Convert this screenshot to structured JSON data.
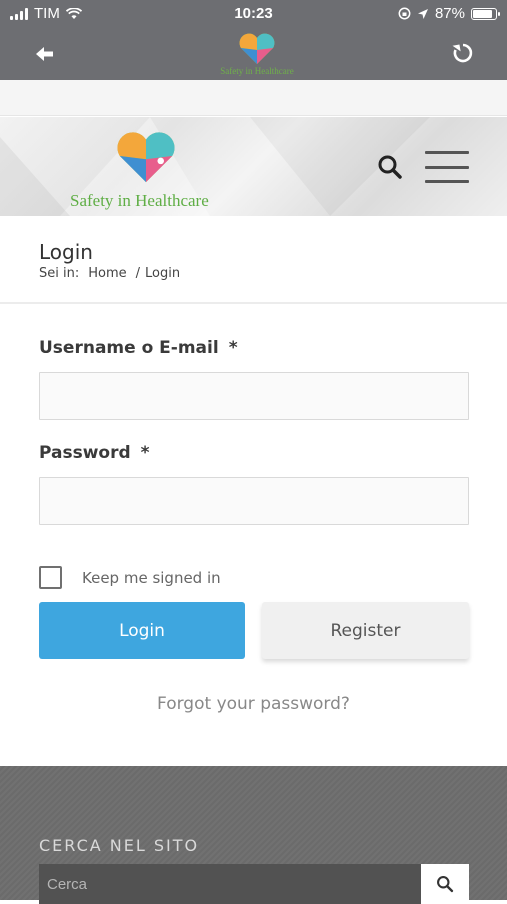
{
  "status_bar": {
    "carrier": "TIM",
    "time": "10:23",
    "battery_percent": "87%",
    "battery_level": 0.87,
    "icons": [
      "signal-icon",
      "wifi-icon",
      "orientation-lock-icon",
      "location-icon",
      "battery-icon"
    ]
  },
  "toolbar": {
    "logo_text": "Safety in Healthcare",
    "icons": [
      "back-arrow-icon",
      "reload-icon"
    ]
  },
  "header": {
    "logo_text": "Safety in Healthcare",
    "icons": [
      "search-icon",
      "menu-icon"
    ]
  },
  "page": {
    "title": "Login",
    "breadcrumb": {
      "prefix": "Sei in:",
      "home": "Home",
      "separator": "/",
      "current": "Login"
    }
  },
  "form": {
    "username_label": "Username o E-mail",
    "username_value": "",
    "password_label": "Password",
    "password_value": "",
    "required_mark": "*",
    "remember_label": "Keep me signed in",
    "remember_checked": false,
    "login_button": "Login",
    "register_button": "Register",
    "forgot_link": "Forgot your password?"
  },
  "footer": {
    "heading": "CERCA NEL SITO",
    "search_placeholder": "Cerca"
  },
  "colors": {
    "topbar": "#6d6e72",
    "primary_button": "#3ea6df",
    "logo_green": "#5fae45",
    "footer_bg": "#6b6b6b"
  }
}
